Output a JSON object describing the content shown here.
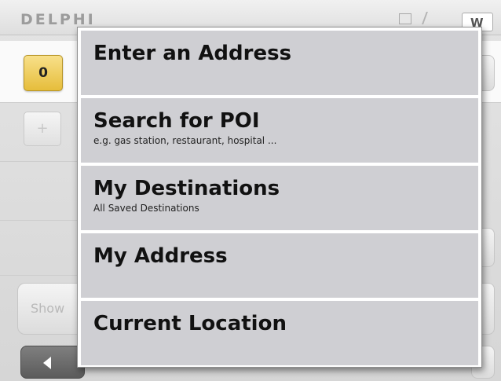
{
  "app": {
    "brand": "DELPHI",
    "badge_count": "0",
    "plus_label": "+",
    "show_label": "Show",
    "w_label": "W"
  },
  "menu": {
    "items": [
      {
        "title": "Enter an Address",
        "subtitle": ""
      },
      {
        "title": "Search for POI",
        "subtitle": "e.g. gas station, restaurant, hospital ..."
      },
      {
        "title": "My Destinations",
        "subtitle": "All Saved Destinations"
      },
      {
        "title": "My Address",
        "subtitle": ""
      },
      {
        "title": "Current Location",
        "subtitle": ""
      }
    ]
  },
  "icons": {
    "back": "back-arrow-icon",
    "plus": "plus-icon",
    "signal": "signal-icon",
    "status": "status-icon"
  },
  "colors": {
    "badge": "#e6bd3b",
    "menu_item_bg": "#cfcfd3",
    "back_button": "#6b6b6b"
  }
}
